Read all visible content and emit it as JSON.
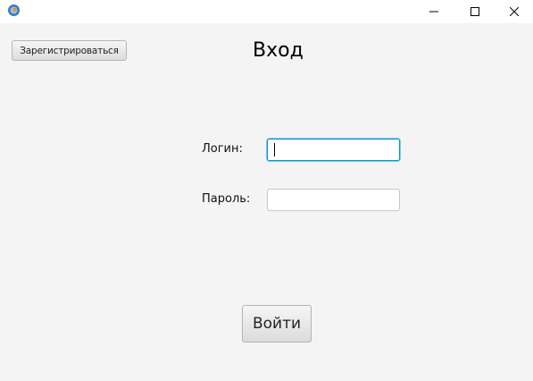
{
  "window": {
    "icon": "java-app-icon",
    "controls": {
      "minimize_icon": "minimize-icon",
      "maximize_icon": "maximize-icon",
      "close_icon": "close-icon"
    }
  },
  "header": {
    "register_label": "Зарегистрироваться",
    "title": "Вход"
  },
  "form": {
    "login_label": "Логин:",
    "login_value": "",
    "password_label": "Пароль:",
    "password_value": "",
    "submit_label": "Войти"
  },
  "colors": {
    "background": "#f4f4f4",
    "focus_border": "#0096c9"
  }
}
